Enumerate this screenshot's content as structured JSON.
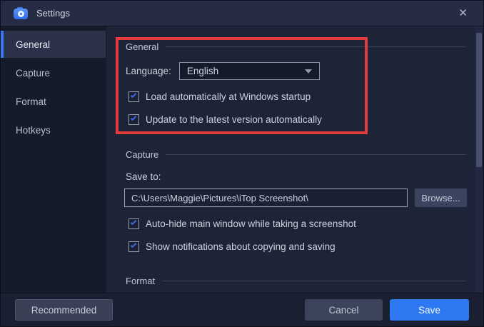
{
  "window": {
    "title": "Settings",
    "close_icon": "✕"
  },
  "sidebar": {
    "items": [
      {
        "label": "General",
        "selected": true
      },
      {
        "label": "Capture",
        "selected": false
      },
      {
        "label": "Format",
        "selected": false
      },
      {
        "label": "Hotkeys",
        "selected": false
      }
    ]
  },
  "content": {
    "general": {
      "header": "General",
      "language_label": "Language:",
      "language_value": "English",
      "checkboxes": [
        {
          "label": "Load automatically at Windows startup",
          "checked": true
        },
        {
          "label": "Update to the latest version automatically",
          "checked": true
        }
      ]
    },
    "capture": {
      "header": "Capture",
      "save_to_label": "Save to:",
      "save_path": "C:\\Users\\Maggie\\Pictures\\iTop Screenshot\\",
      "browse_label": "Browse...",
      "checkboxes": [
        {
          "label": "Auto-hide main window while taking a screenshot",
          "checked": true
        },
        {
          "label": "Show notifications about copying and saving",
          "checked": true
        }
      ]
    },
    "format": {
      "header": "Format"
    }
  },
  "footer": {
    "recommended_label": "Recommended",
    "cancel_label": "Cancel",
    "save_label": "Save"
  },
  "colors": {
    "accent_blue": "#2e79f2",
    "selected_tab_blue": "#3478f6",
    "annotation_red": "#e23c3c",
    "checkbox_check_blue": "#3b6cd9"
  }
}
